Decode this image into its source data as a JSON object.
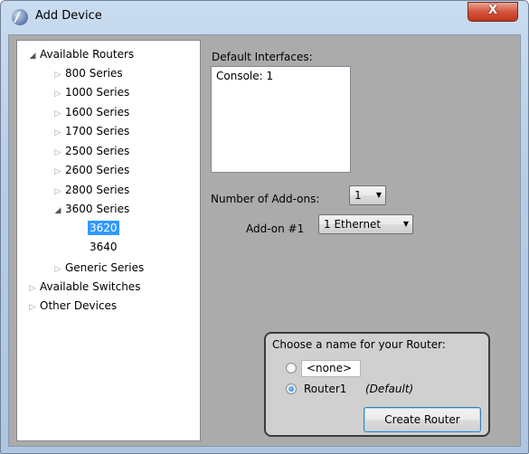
{
  "window": {
    "title": "Add Device",
    "close_label": "X"
  },
  "tree": {
    "items": [
      {
        "label": "Available Routers",
        "state": "expanded",
        "level": 0
      },
      {
        "label": "800 Series",
        "state": "collapsed",
        "level": 1
      },
      {
        "label": "1000 Series",
        "state": "collapsed",
        "level": 1
      },
      {
        "label": "1600 Series",
        "state": "collapsed",
        "level": 1
      },
      {
        "label": "1700 Series",
        "state": "collapsed",
        "level": 1
      },
      {
        "label": "2500 Series",
        "state": "collapsed",
        "level": 1
      },
      {
        "label": "2600 Series",
        "state": "collapsed",
        "level": 1
      },
      {
        "label": "2800 Series",
        "state": "collapsed",
        "level": 1
      },
      {
        "label": "3600 Series",
        "state": "expanded",
        "level": 1
      },
      {
        "label": "3620",
        "state": "leaf",
        "level": 2,
        "selected": true
      },
      {
        "label": "3640",
        "state": "leaf",
        "level": 2
      },
      {
        "label": "Generic Series",
        "state": "collapsed",
        "level": 1
      },
      {
        "label": "Available Switches",
        "state": "collapsed",
        "level": 0
      },
      {
        "label": "Other Devices",
        "state": "collapsed",
        "level": 0
      }
    ]
  },
  "details": {
    "default_interfaces_label": "Default Interfaces:",
    "default_interfaces_value": "Console: 1",
    "addons_count_label": "Number of Add-ons:",
    "addons_count_value": "1",
    "addon1_label": "Add-on #1",
    "addon1_value": "1 Ethernet"
  },
  "naming": {
    "group_label": "Choose a name for your Router:",
    "option_none": "<none>",
    "option_router": "Router1",
    "option_router_note": "(Default)",
    "selected": "Router1",
    "create_button": "Create Router"
  },
  "colors": {
    "selection": "#3399ff",
    "close_button": "#c0361c"
  }
}
